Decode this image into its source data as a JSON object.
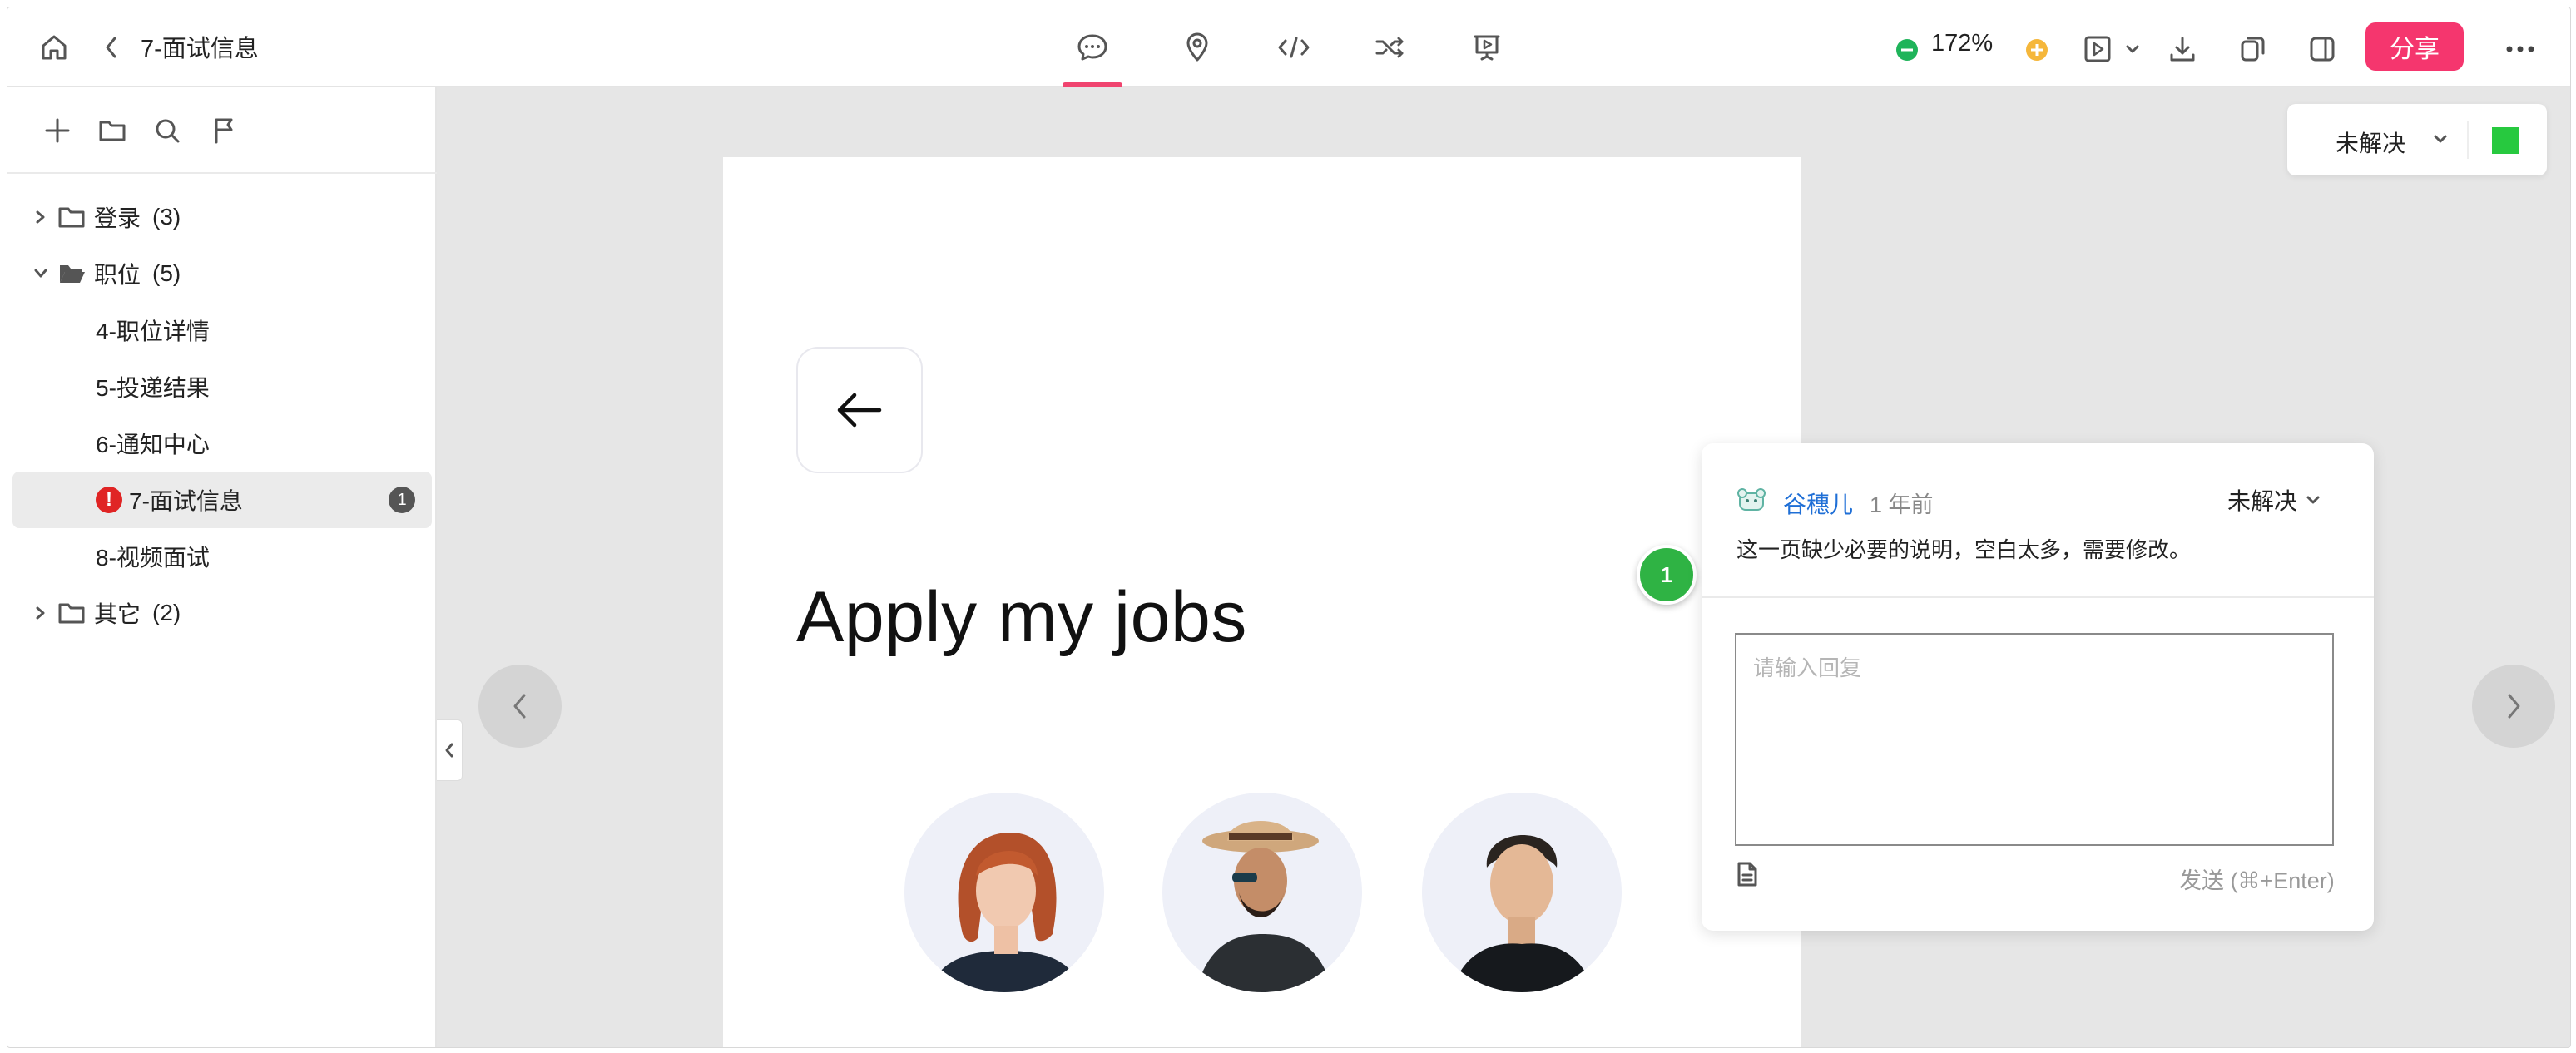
{
  "header": {
    "title": "7-面试信息",
    "zoom": "172%",
    "share_label": "分享",
    "tabs": [
      {
        "name": "comment-icon",
        "active": true
      },
      {
        "name": "location-pin-icon",
        "active": false
      },
      {
        "name": "code-icon",
        "active": false
      },
      {
        "name": "shuffle-icon",
        "active": false
      },
      {
        "name": "presentation-icon",
        "active": false
      }
    ],
    "accent": "#f5366e"
  },
  "sidebar": {
    "tree": [
      {
        "label": "登录",
        "count": "(3)",
        "type": "folder",
        "expanded": false
      },
      {
        "label": "职位",
        "count": "(5)",
        "type": "folder",
        "expanded": true
      },
      {
        "label": "4-职位详情",
        "type": "page"
      },
      {
        "label": "5-投递结果",
        "type": "page"
      },
      {
        "label": "6-通知中心",
        "type": "page"
      },
      {
        "label": "7-面试信息",
        "type": "page",
        "active": true,
        "error": "!",
        "badge": "1"
      },
      {
        "label": "8-视频面试",
        "type": "page"
      },
      {
        "label": "其它",
        "count": "(2)",
        "type": "folder",
        "expanded": false
      }
    ]
  },
  "canvas": {
    "heading": "Apply my jobs",
    "status_filter": "未解决",
    "status_color": "#27c93f"
  },
  "comment": {
    "pin_number": "1",
    "author": "谷穗儿",
    "time": "1 年前",
    "status": "未解决",
    "text": "这一页缺少必要的说明，空白太多，需要修改。",
    "reply_placeholder": "请输入回复",
    "send_label": "发送 (⌘+Enter)"
  }
}
